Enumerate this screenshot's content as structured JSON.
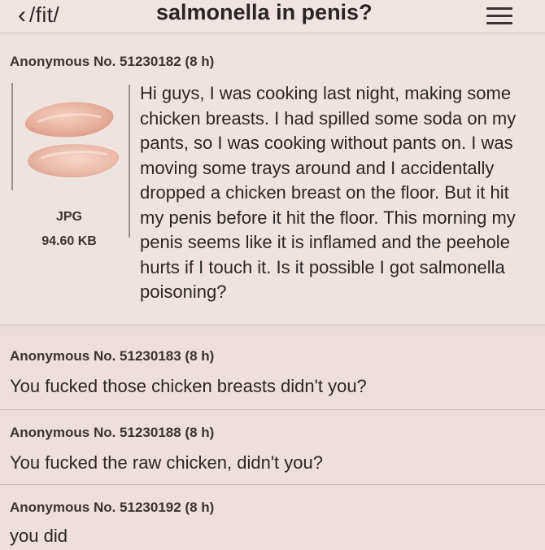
{
  "header": {
    "back_icon": "chevron-left-icon",
    "board": "/fit/",
    "title": "salmonella in penis?",
    "menu_icon": "hamburger-menu-icon"
  },
  "op": {
    "header": "Anonymous No. 51230182 (8 h)",
    "image": {
      "description_icon": "raw-chicken-breasts-image",
      "type": "JPG",
      "size": "94.60 KB"
    },
    "text": "Hi guys, I was cooking last night, making some chicken breasts. I had spilled some soda on my pants, so I was cooking without pants on. I was moving some trays around and I accidentally dropped a chicken breast on the floor. But it hit my penis before it hit the floor. This morning my penis seems like it is inflamed and the peehole hurts if I touch it. Is it possible I got salmonella poisoning?"
  },
  "replies": [
    {
      "header": "Anonymous No. 51230183 (8 h)",
      "text": "You fucked those chicken breasts didn't you?"
    },
    {
      "header": "Anonymous No. 51230188 (8 h)",
      "text": "You fucked the raw chicken, didn't you?"
    },
    {
      "header": "Anonymous No. 51230192 (8 h)",
      "text": "you did"
    }
  ]
}
